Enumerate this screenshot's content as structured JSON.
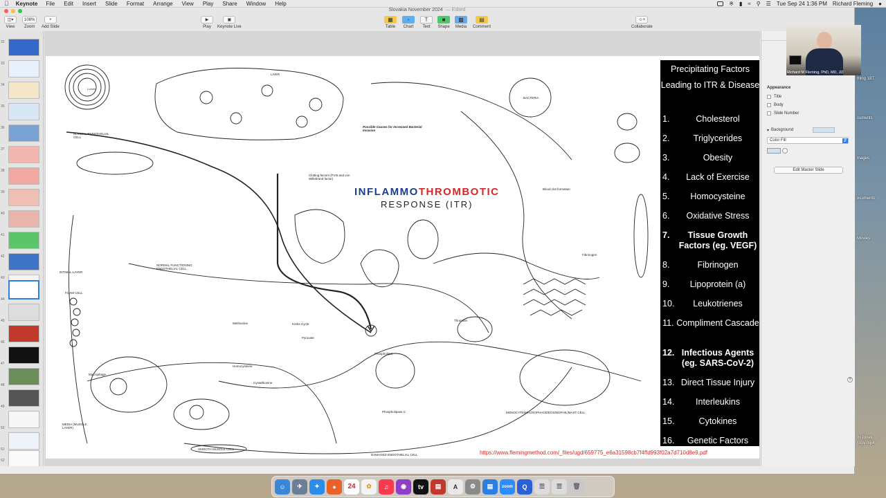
{
  "menubar": {
    "app_name": "Keynote",
    "items": [
      "File",
      "Edit",
      "Insert",
      "Slide",
      "Format",
      "Arrange",
      "View",
      "Play",
      "Share",
      "Window",
      "Help"
    ],
    "datetime": "Tue Sep 24  1:36 PM",
    "user": "Richard Fleming"
  },
  "window": {
    "title": "Slovakia November 2024",
    "edited": "— Edited"
  },
  "toolbar": {
    "view_label": "View",
    "zoom_value": "108%",
    "zoom_label": "Zoom",
    "add_slide_label": "Add Slide",
    "play_label": "Play",
    "keynote_live_label": "Keynote Live",
    "table_label": "Table",
    "chart_label": "Chart",
    "text_label": "Text",
    "shape_label": "Shape",
    "media_label": "Media",
    "comment_label": "Comment",
    "collaborate_label": "Collaborate"
  },
  "navigator": {
    "slide_numbers": [
      "32",
      "33",
      "34",
      "35",
      "36",
      "37",
      "38",
      "39",
      "40",
      "41",
      "42",
      "43",
      "44",
      "45",
      "46",
      "47",
      "48",
      "49",
      "50",
      "51",
      "52"
    ],
    "selected": "44"
  },
  "slide": {
    "diagram_title_part1": "INFLAMMO",
    "diagram_title_part2": "THROMBOTIC",
    "diagram_subtitle": "RESPONSE (ITR)",
    "panel_heading": "Precipitating Factors",
    "panel_subheading": "Leading to ITR & Disease",
    "factors": [
      {
        "num": "1.",
        "text": "Cholesterol"
      },
      {
        "num": "2.",
        "text": "Triglycerides"
      },
      {
        "num": "3.",
        "text": "Obesity"
      },
      {
        "num": "4.",
        "text": "Lack of Exercise"
      },
      {
        "num": "5.",
        "text": "Homocysteine"
      },
      {
        "num": "6.",
        "text": "Oxidative Stress"
      },
      {
        "num": "7.",
        "text": "Tissue Growth Factors (eg. VEGF)"
      },
      {
        "num": "8.",
        "text": "Fibrinogen"
      },
      {
        "num": "9.",
        "text": "Lipoprotein (a)"
      },
      {
        "num": "10.",
        "text": "Leukotrienes"
      },
      {
        "num": "11.",
        "text": "Compliment Cascade"
      },
      {
        "num": "12.",
        "text": "Infectious Agents (eg. SARS-CoV-2)"
      },
      {
        "num": "13.",
        "text": "Direct Tissue Injury"
      },
      {
        "num": "14.",
        "text": "Interleukins"
      },
      {
        "num": "15.",
        "text": "Cytokines"
      },
      {
        "num": "16.",
        "text": "Genetic Factors"
      }
    ],
    "pdf_link": "https://www.flemingmethod.com/_files/ugd/659775_e6a31598cb7f4ffd993f02a7d710d8e9.pdf",
    "diagram_labels": {
      "liver": "LIVER",
      "normal_endothelial": "NORMAL ENDOTHELIAL CELL",
      "normal_functioning": "NORMAL FUNCTIONING ENDOTHELIAL CELL",
      "intimal_layer": "INTIMAL LAYER",
      "foam_cell": "FOAM CELL",
      "macrophage": "Macrophage",
      "media": "MEDIA (MUSCLE LAYER)",
      "smooth_muscle": "SMOOTH MUSCLE CELL",
      "damaged_endothelial": "DAMAGED ENDOTHELIAL CELL",
      "monocyte": "MONOCYTE/MACROPHAGE/EOSINOPHIL/MAST CELL",
      "bacteria": "BACTERIA",
      "clotting": "Clotting factors (FVIII and von Willebrand factor)",
      "thrombin": "Thrombin",
      "fibrinogen": "Fibrinogen",
      "phospholipid": "Phospholipid",
      "phospholipase": "Phospholipase C",
      "blood_clot": "Blood clot formation",
      "methionine": "Methionine",
      "homocysteine": "Homocysteine",
      "cystathionine": "Cystathionine",
      "krebs": "Krebs Cycle",
      "pyruvate": "Pyruvate",
      "causes_heading": "Possible Causes for Increased Bacterial Invasion"
    }
  },
  "inspector": {
    "appearance_label": "Appearance",
    "title_label": "Title",
    "body_label": "Body",
    "slide_number_label": "Slide Number",
    "background_label": "Background",
    "fill_value": "Color Fill",
    "edit_master_label": "Edit Master Slide"
  },
  "video": {
    "caption": "Richard M Fleming, PhD, MD, JD"
  },
  "desktop": {
    "files": [
      "ming 18T",
      "cuments",
      "mages",
      "ocuments",
      "Movies",
      "m Jones",
      "copy.mp4"
    ]
  },
  "dock": {
    "calendar_day": "24",
    "zoom_label": "zoom"
  }
}
